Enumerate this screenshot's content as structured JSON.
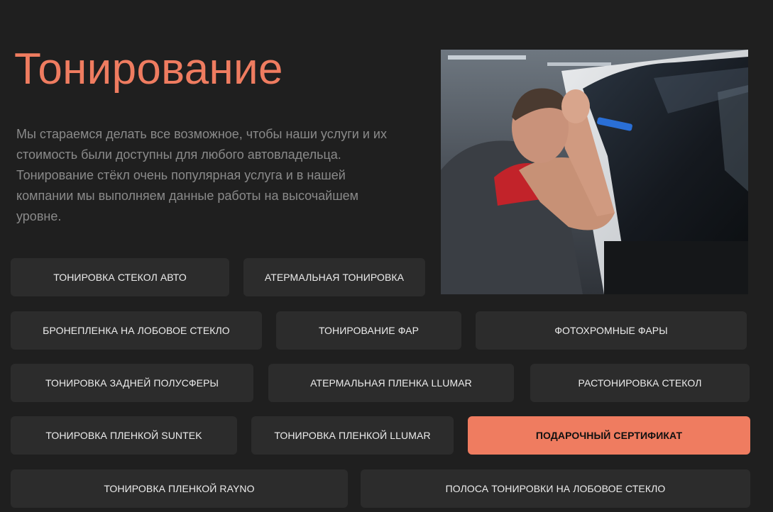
{
  "page": {
    "title": "Тонирование",
    "description": "Мы стараемся делать все возможное, чтобы наши услуги и их стоимость были доступны для любого автовладельца. Тонирование стёкл очень популярная услуга и в нашей компании мы выполняем данные работы на высочайшем уровне."
  },
  "colors": {
    "background": "#1f1f1f",
    "accent": "#ef7c60",
    "button": "#2c2c2c",
    "text_muted": "#8a8a8a"
  },
  "photo": {
    "subject": "technician-tinting-car-window"
  },
  "services": [
    "ТОНИРОВКА СТЕКОЛ АВТО",
    "АТЕРМАЛЬНАЯ ТОНИРОВКА",
    "БРОНЕПЛЕНКА НА ЛОБОВОЕ СТЕКЛО",
    "ТОНИРОВАНИЕ ФАР",
    "ФОТОХРОМНЫЕ ФАРЫ",
    "ТОНИРОВКА ЗАДНЕЙ ПОЛУСФЕРЫ",
    "АТЕРМАЛЬНАЯ ПЛЕНКА LLUMAR",
    "РАСТОНИРОВКА СТЕКОЛ",
    "ТОНИРОВКА ПЛЕНКОЙ SUNTEK",
    "ТОНИРОВКА ПЛЕНКОЙ LLUMAR",
    "ПОДАРОЧНЫЙ СЕРТИФИКАТ",
    "ТОНИРОВКА ПЛЕНКОЙ RAYNO",
    "ПОЛОСА ТОНИРОВКИ НА ЛОБОВОЕ СТЕКЛО"
  ]
}
